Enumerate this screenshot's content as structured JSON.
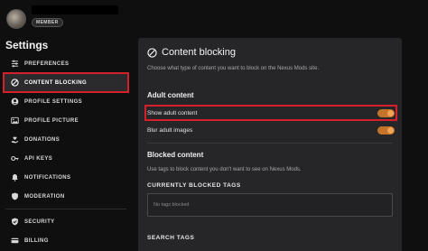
{
  "user": {
    "badge": "MEMBER"
  },
  "sidebar": {
    "title": "Settings",
    "items": [
      {
        "label": "PREFERENCES",
        "icon": "sliders-icon"
      },
      {
        "label": "CONTENT BLOCKING",
        "icon": "block-icon"
      },
      {
        "label": "PROFILE SETTINGS",
        "icon": "user-icon"
      },
      {
        "label": "PROFILE PICTURE",
        "icon": "picture-icon"
      },
      {
        "label": "DONATIONS",
        "icon": "donation-icon"
      },
      {
        "label": "API KEYS",
        "icon": "key-icon"
      },
      {
        "label": "NOTIFICATIONS",
        "icon": "bell-icon"
      },
      {
        "label": "MODERATION",
        "icon": "shield-icon"
      },
      {
        "label": "SECURITY",
        "icon": "shield-check-icon"
      },
      {
        "label": "BILLING",
        "icon": "card-icon"
      }
    ]
  },
  "main": {
    "title": "Content blocking",
    "subtitle": "Choose what type of content you want to block on the Nexus Mods site.",
    "adult": {
      "heading": "Adult content",
      "show_label": "Show adult content",
      "show_enabled": true,
      "blur_label": "Blur adult images",
      "blur_enabled": true
    },
    "blocked": {
      "heading": "Blocked content",
      "subtitle": "Use tags to block content you don't want to see on Nexus Mods.",
      "current_label": "CURRENTLY BLOCKED TAGS",
      "empty_text": "No tags blocked",
      "search_label": "SEARCH TAGS"
    }
  },
  "colors": {
    "accent": "#d4202a",
    "toggle": "#c4742a",
    "panel": "#262628",
    "background": "#0f0f10"
  }
}
